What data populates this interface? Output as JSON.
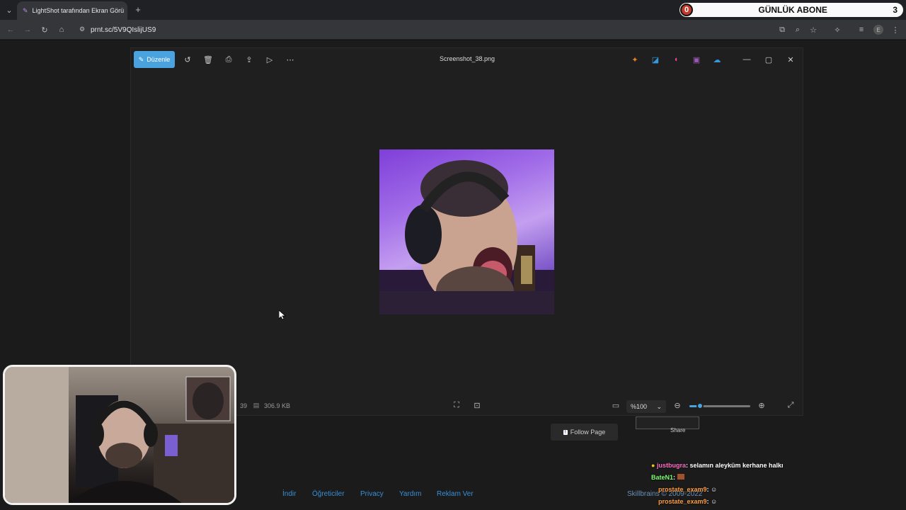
{
  "browser": {
    "tab_title": "LightShot tarafından Ekran Görü",
    "url": "prnt.sc/5V9QIslijUS9"
  },
  "overlay": {
    "daily_label": "GÜNLÜK ABONE",
    "current": "0",
    "target": "3"
  },
  "viewer": {
    "edit_label": "Düzenle",
    "filename": "Screenshot_38.png",
    "file_size": "306.9 KB",
    "partial_dim": "39",
    "zoom_label": "%100",
    "zoom_fraction": 0.18
  },
  "page": {
    "follow_label": "Follow Page",
    "share_label": "Share",
    "footer_links": [
      "İndir",
      "Öğreticiler",
      "Privacy",
      "Yardım",
      "Reklam Ver"
    ],
    "copyright": "Skillbrains © 2009-2022"
  },
  "chat": [
    {
      "user": "justbugra",
      "user_color": "#ff6ec7",
      "text": "selamın aleyküm kerhane halkı"
    },
    {
      "user": "BateN1",
      "user_color": "#7dff6e",
      "text": ""
    },
    {
      "user": "prostate_exam9",
      "user_color": "#ff9f43",
      "text": ""
    },
    {
      "user": "prostate_exam9",
      "user_color": "#ff9f43",
      "text": ""
    }
  ]
}
